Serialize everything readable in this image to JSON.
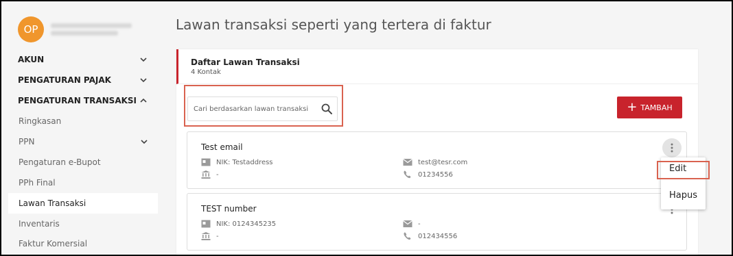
{
  "profile": {
    "initials": "OP"
  },
  "sidebar": {
    "sections": [
      {
        "label": "AKUN"
      },
      {
        "label": "PENGATURAN PAJAK"
      },
      {
        "label": "PENGATURAN TRANSAKSI"
      }
    ],
    "sub_items": [
      {
        "label": "Ringkasan"
      },
      {
        "label": "PPN"
      },
      {
        "label": "Pengaturan e-Bupot"
      },
      {
        "label": "PPh Final"
      },
      {
        "label": "Lawan Transaksi"
      },
      {
        "label": "Inventaris"
      },
      {
        "label": "Faktur Komersial"
      }
    ],
    "active_item": "Lawan Transaksi"
  },
  "page": {
    "title": "Lawan transaksi seperti yang tertera di faktur"
  },
  "card": {
    "title": "Daftar Lawan Transaksi",
    "count": "4 Kontak"
  },
  "search": {
    "placeholder": "Cari berdasarkan lawan transaksi"
  },
  "add_button": {
    "label": "TAMBAH"
  },
  "contacts": [
    {
      "name": "Test email",
      "nik": "NIK: Testaddress",
      "address": "-",
      "email": "test@tesr.com",
      "phone": "01234556"
    },
    {
      "name": "TEST number",
      "nik": "NIK: 0124345235",
      "address": "-",
      "email": "-",
      "phone": "012434556"
    }
  ],
  "context_menu": {
    "edit": "Edit",
    "delete": "Hapus"
  },
  "colors": {
    "accent": "#c8232c",
    "avatar": "#f0962c",
    "highlight": "#d9624f"
  }
}
